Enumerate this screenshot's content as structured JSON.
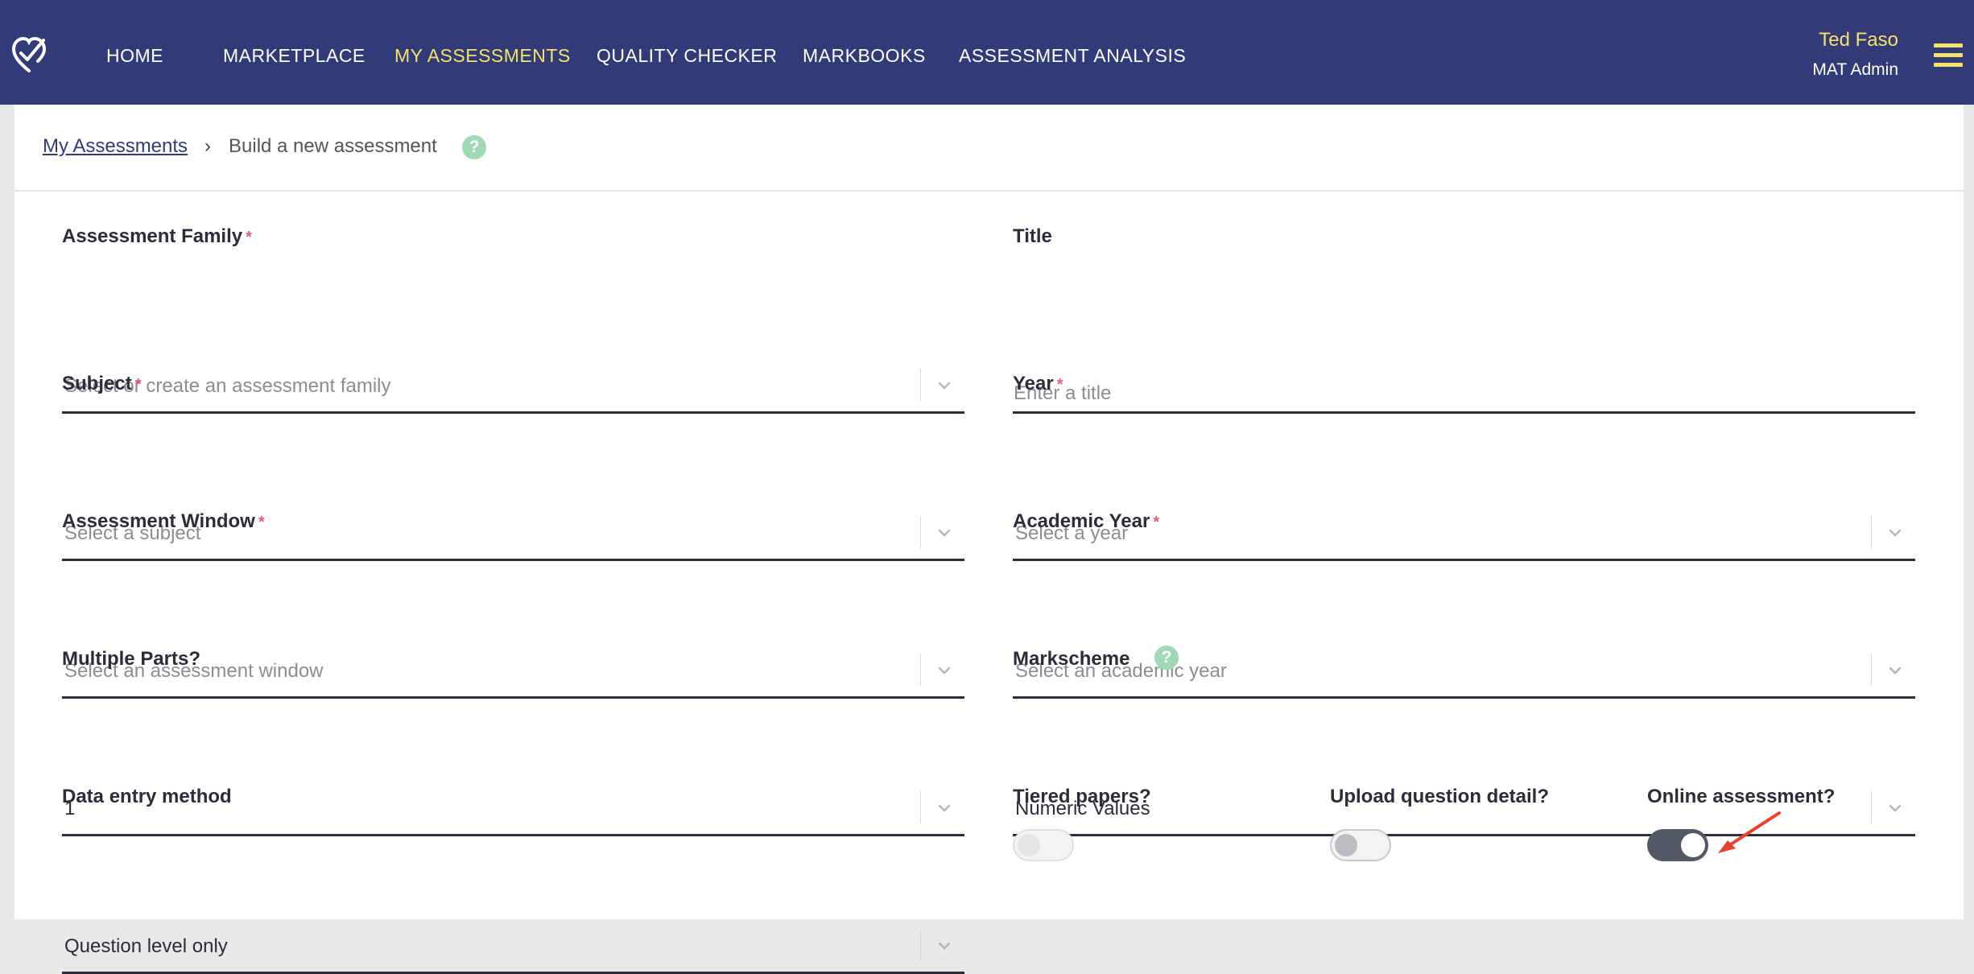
{
  "nav": {
    "items": [
      {
        "label": "HOME",
        "active": false
      },
      {
        "label": "MARKETPLACE",
        "active": false
      },
      {
        "label": "MY ASSESSMENTS",
        "active": true
      },
      {
        "label": "QUALITY CHECKER",
        "active": false
      },
      {
        "label": "MARKBOOKS",
        "active": false
      },
      {
        "label": "ASSESSMENT ANALYSIS",
        "active": false
      }
    ],
    "user_name": "Ted Faso",
    "user_role": "MAT Admin",
    "logo_icon": "heart-check-logo-icon",
    "menu_icon": "hamburger-menu-icon"
  },
  "breadcrumb": {
    "parent": "My Assessments",
    "separator": "›",
    "current": "Build a new assessment",
    "help": "?"
  },
  "form": {
    "assessment_family": {
      "label": "Assessment Family",
      "required_mark": "*",
      "placeholder": "Select or create an assessment family"
    },
    "title": {
      "label": "Title",
      "placeholder": "Enter a title"
    },
    "subject": {
      "label": "Subject",
      "required_mark": "*",
      "placeholder": "Select a subject"
    },
    "year": {
      "label": "Year",
      "required_mark": "*",
      "placeholder": "Select a year"
    },
    "assessment_window": {
      "label": "Assessment Window",
      "required_mark": "*",
      "placeholder": "Select an assessment window"
    },
    "academic_year": {
      "label": "Academic Year",
      "required_mark": "*",
      "placeholder": "Select an academic year"
    },
    "multiple_parts": {
      "label": "Multiple Parts?",
      "value": "1"
    },
    "markscheme": {
      "label": "Markscheme",
      "help": "?",
      "value": "Numeric Values"
    },
    "data_entry_method": {
      "label": "Data entry method",
      "value": "Question level only"
    },
    "tiered_papers": {
      "label": "Tiered papers?",
      "checked": false
    },
    "upload_question_detail": {
      "label": "Upload question detail?",
      "checked": false
    },
    "online_assessment": {
      "label": "Online assessment?",
      "checked": true
    }
  },
  "colors": {
    "nav_bg": "#323b78",
    "accent_yellow": "#f3e36a",
    "required_red": "#e2606a",
    "help_green": "#9fd9b6",
    "annotation_arrow": "#e8412c"
  }
}
